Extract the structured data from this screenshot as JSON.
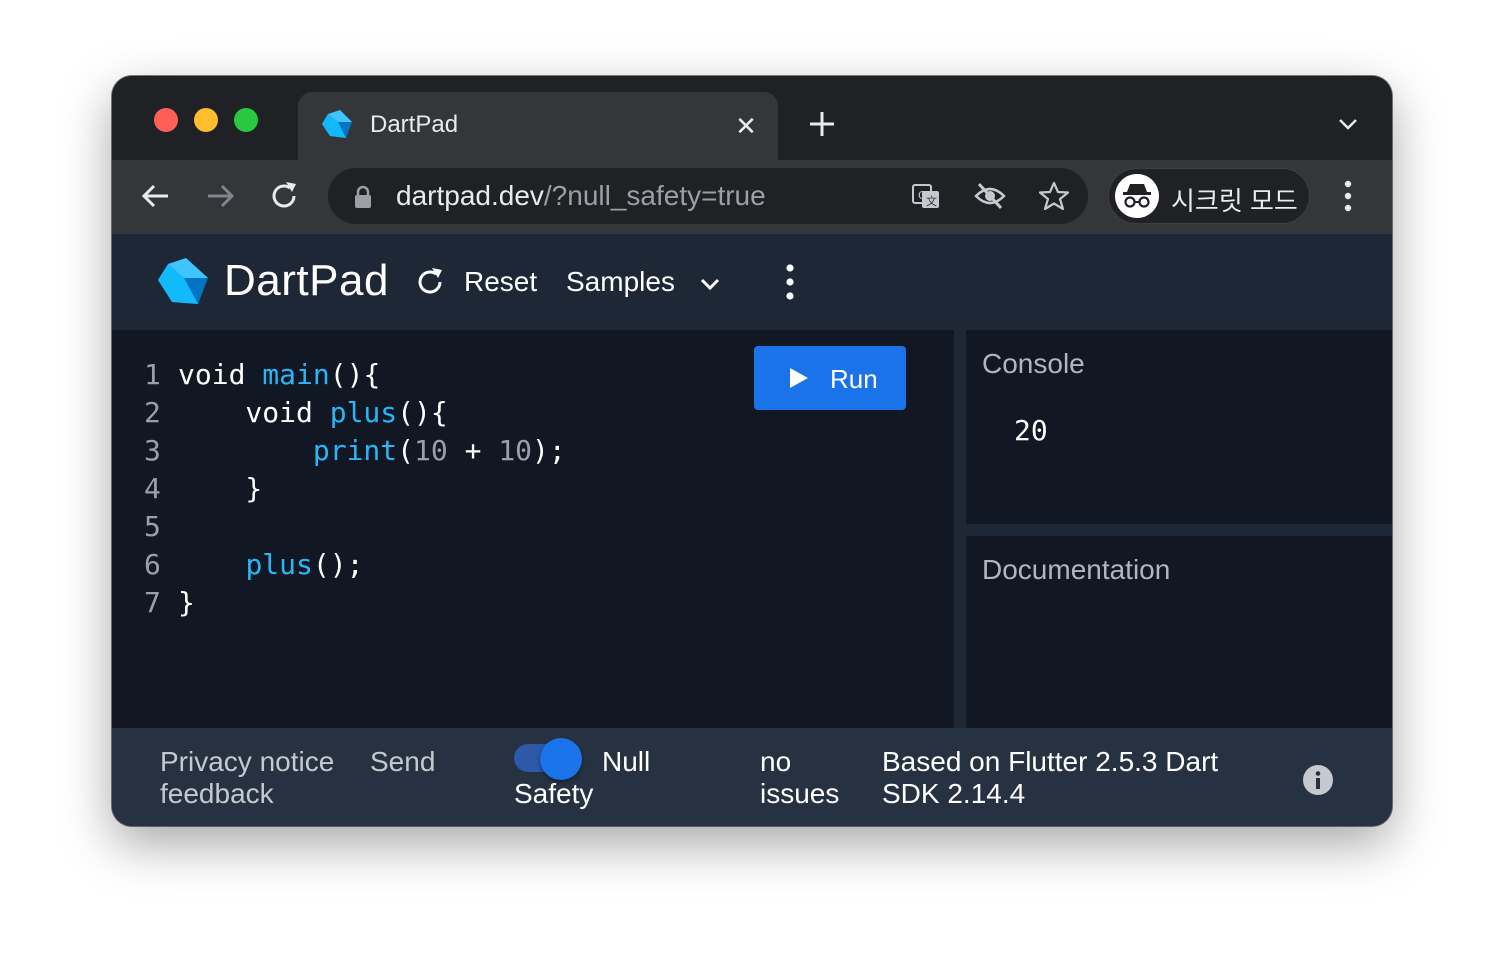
{
  "tab": {
    "title": "DartPad",
    "close_glyph": "✕"
  },
  "toolbar": {
    "url_host": "dartpad.dev",
    "url_path": "/?null_safety=true",
    "incognito_label": "시크릿 모드"
  },
  "header": {
    "app_title": "DartPad",
    "reset_label": "Reset",
    "samples_label": "Samples"
  },
  "editor": {
    "line_numbers": [
      "1",
      "2",
      "3",
      "4",
      "5",
      "6",
      "7"
    ],
    "lines": {
      "l1_kw": "void ",
      "l1_fn": "main",
      "l1_rest": "(){",
      "l2_kw": "    void ",
      "l2_fn": "plus",
      "l2_rest": "(){",
      "l3_indent": "        ",
      "l3_fn": "print",
      "l3_open": "(",
      "l3_num1": "10",
      "l3_op": " + ",
      "l3_num2": "10",
      "l3_close": ");",
      "l4": "    }",
      "l6_indent": "    ",
      "l6_fn": "plus",
      "l6_rest": "();",
      "l7": "}"
    },
    "run_label": "Run"
  },
  "console": {
    "title": "Console",
    "output": "20"
  },
  "documentation": {
    "title": "Documentation"
  },
  "footer": {
    "privacy_line1": "Privacy notice",
    "send_line1": "Send",
    "feedback_line2": "feedback",
    "null_line1": "Null",
    "safety_line2": "Safety",
    "no_line1": "no",
    "issues_line2": "issues",
    "version_line1": "Based on Flutter 2.5.3 Dart",
    "version_line2": "SDK 2.14.4",
    "null_safety_enabled": true
  },
  "colors": {
    "accent": "#1a73e8",
    "function": "#29b6f6",
    "header_bg": "#1d2735",
    "editor_bg": "#111824",
    "footer_bg": "#263242"
  }
}
